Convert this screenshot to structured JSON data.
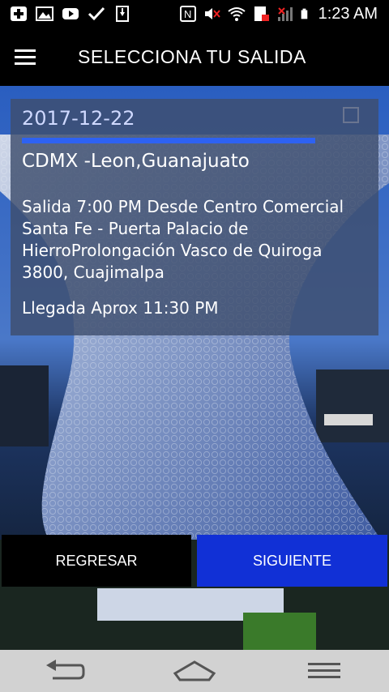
{
  "status_bar": {
    "icons": [
      "add-icon",
      "image-icon",
      "youtube-icon",
      "check-icon",
      "download-icon",
      "nfc-icon",
      "mute-icon",
      "wifi-icon",
      "sim-icon",
      "signal-icon",
      "battery-icon"
    ],
    "time": "1:23 AM"
  },
  "app_bar": {
    "title": "SELECCIONA TU SALIDA"
  },
  "card": {
    "date": "2017-12-22",
    "route": "CDMX -Leon,Guanajuato",
    "departure": "Salida 7:00 PM Desde Centro Comercial Santa Fe - Puerta Palacio de HierroProlongación Vasco de Quiroga 3800, Cuajimalpa",
    "arrival": "Llegada Aprox 11:30 PM"
  },
  "buttons": {
    "back_label": "REGRESAR",
    "next_label": "SIGUIENTE"
  },
  "colors": {
    "accent": "#1130d6",
    "divider": "#2e62f2",
    "card_bg": "#3e4e6e"
  }
}
